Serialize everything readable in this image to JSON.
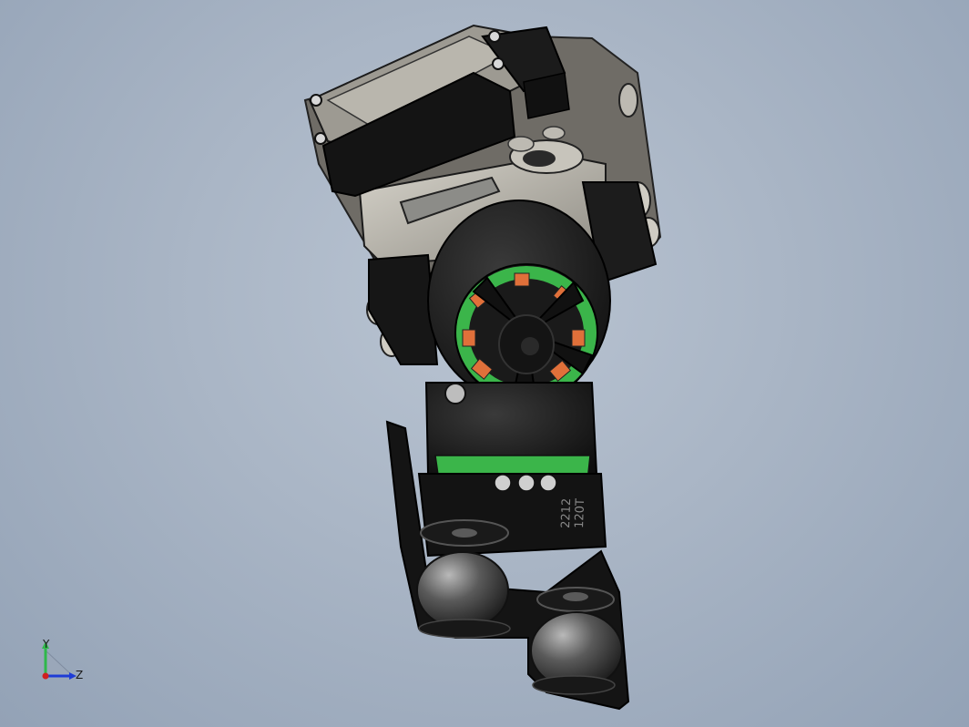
{
  "viewport": {
    "background_top": "#b9c4d2",
    "background_bottom": "#93a2b6"
  },
  "model": {
    "description_icon": "gimbal-assembly-3d-model",
    "motor_label_line1": "2212",
    "motor_label_line2": "120T",
    "colors": {
      "body": "#1c1c1c",
      "camera_shell": "#b5b2a8",
      "motor_coil_green": "#3bb54a",
      "motor_coil_orange": "#e0703a",
      "damper_ball": "#4a4a4a"
    }
  },
  "triad": {
    "y_label": "Y",
    "z_label": "Z",
    "y_color": "#2fb84a",
    "z_color": "#1e3cd6",
    "x_color": "#d02020"
  }
}
